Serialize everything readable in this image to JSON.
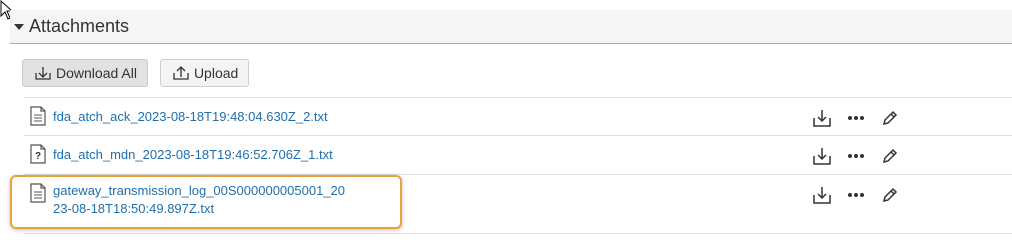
{
  "section": {
    "title": "Attachments"
  },
  "toolbar": {
    "download_all_label": "Download All",
    "upload_label": "Upload"
  },
  "attachments": [
    {
      "name": "fda_atch_ack_2023-08-18T19:48:04.630Z_2.txt",
      "icon": "text-file-icon"
    },
    {
      "name": "fda_atch_mdn_2023-08-18T19:46:52.706Z_1.txt",
      "icon": "unknown-file-icon"
    },
    {
      "name_line1": "gateway_transmission_log_00S000000005001_20",
      "name_line2": "23-08-18T18:50:49.897Z.txt",
      "icon": "text-file-icon"
    }
  ],
  "colors": {
    "accent": "#e8a33c",
    "link": "#1f6fad",
    "header_bg": "#f5f5f5"
  }
}
